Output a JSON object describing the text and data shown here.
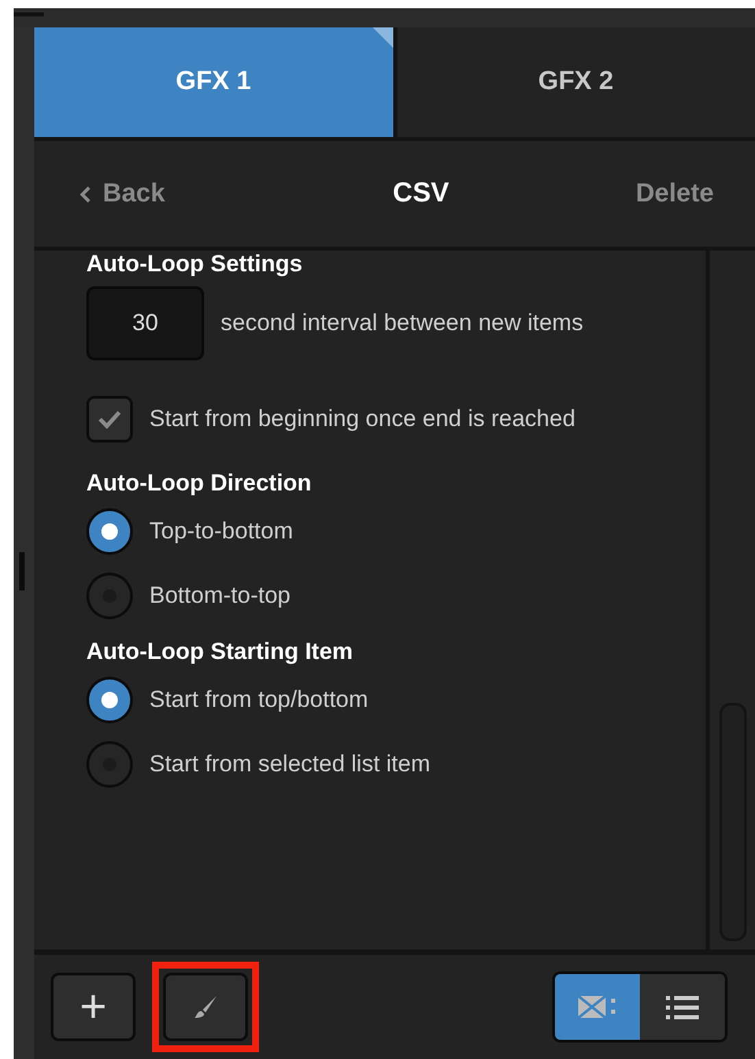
{
  "tabs": [
    {
      "label": "GFX 1",
      "selected": true
    },
    {
      "label": "GFX 2",
      "selected": false
    }
  ],
  "nav": {
    "back": "Back",
    "title": "CSV",
    "delete": "Delete"
  },
  "sections": [
    {
      "heading": "Auto-Loop Settings",
      "items": [
        {
          "kind": "number",
          "value": "30",
          "label": "second interval between new items"
        },
        {
          "kind": "checkbox",
          "label": "Start from beginning once end is reached",
          "checked": true,
          "disabled": true
        }
      ]
    },
    {
      "heading": "Auto-Loop Direction",
      "items": [
        {
          "kind": "radio",
          "label": "Top-to-bottom",
          "selected": true
        },
        {
          "kind": "radio",
          "label": "Bottom-to-top",
          "selected": false
        }
      ]
    },
    {
      "heading": "Auto-Loop Starting Item",
      "items": [
        {
          "kind": "radio",
          "label": "Start from top/bottom",
          "selected": true
        },
        {
          "kind": "radio",
          "label": "Start from selected list item",
          "selected": false
        }
      ]
    }
  ],
  "footer": {
    "add": "+",
    "brush_highlighted": true,
    "views": [
      {
        "kind": "thumbnails",
        "selected": true
      },
      {
        "kind": "list",
        "selected": false
      }
    ]
  }
}
